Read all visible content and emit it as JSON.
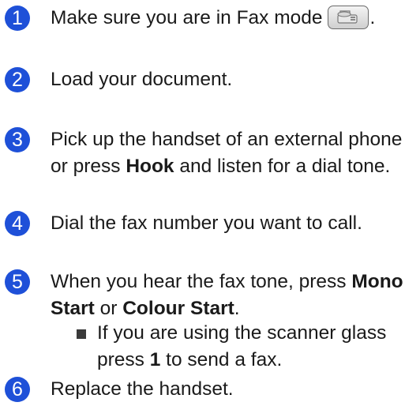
{
  "steps": [
    {
      "number": "1",
      "text": "Make sure you are in Fax mode",
      "suffix": "."
    },
    {
      "number": "2",
      "text": "Load your document."
    },
    {
      "number": "3",
      "text_a": "Pick up the handset of an external phone or press ",
      "bold_a": "Hook",
      "text_b": " and listen for a dial tone."
    },
    {
      "number": "4",
      "text": "Dial the fax number you want to call."
    },
    {
      "number": "5",
      "text_a": "When you hear the fax tone, press ",
      "bold_a": "Mono Start",
      "text_b": " or ",
      "bold_b": "Colour Start",
      "text_c": "."
    },
    {
      "number": "6",
      "text": "Replace the handset."
    }
  ],
  "bullet": {
    "text_a": "If you are using the scanner glass press ",
    "bold_a": "1",
    "text_b": " to send a fax."
  },
  "colors": {
    "step_circle": "#1e50d8",
    "text": "#1a1a1a"
  },
  "icons": {
    "fax_mode": "fax-machine-icon",
    "bullet": "square-bullet-icon"
  }
}
